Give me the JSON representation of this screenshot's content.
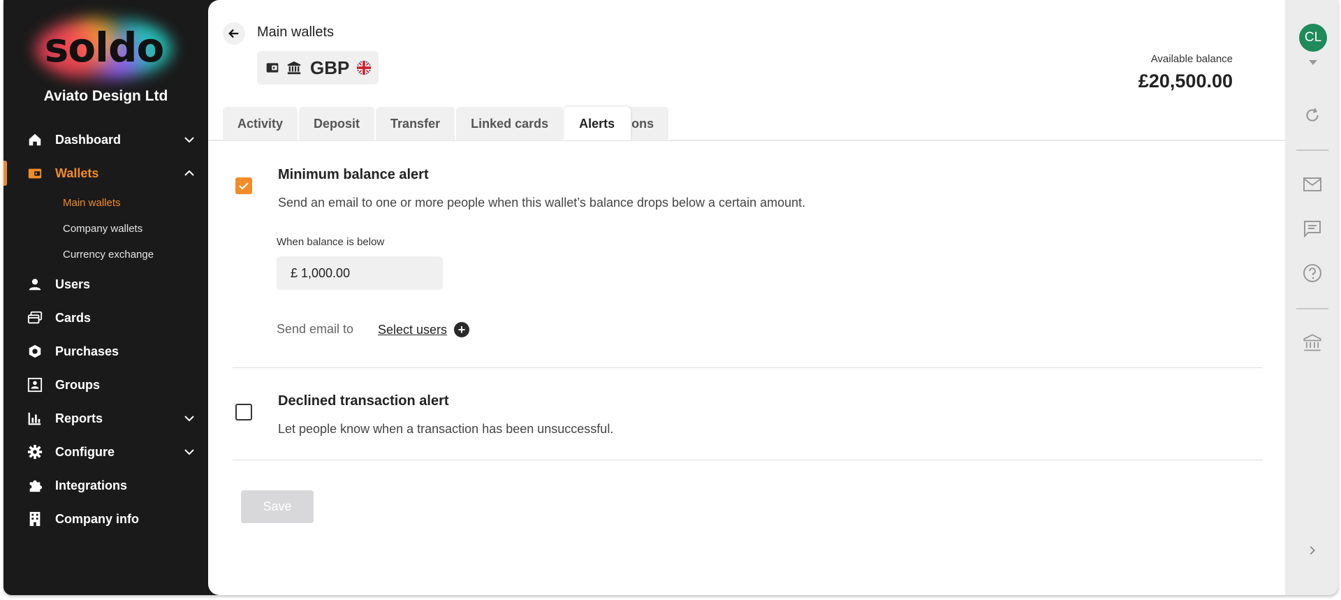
{
  "brand": {
    "logo_text": "soldo",
    "company_name": "Aviato Design Ltd",
    "accent_color": "#f28c28"
  },
  "sidebar": {
    "items": [
      {
        "label": "Dashboard",
        "icon": "home-icon",
        "expandable": true
      },
      {
        "label": "Wallets",
        "icon": "wallet-icon",
        "expandable": true,
        "active": true,
        "children": [
          "Main wallets",
          "Company wallets",
          "Currency exchange"
        ],
        "active_child": "Main wallets"
      },
      {
        "label": "Users",
        "icon": "user-icon"
      },
      {
        "label": "Cards",
        "icon": "cards-icon"
      },
      {
        "label": "Purchases",
        "icon": "purchases-icon"
      },
      {
        "label": "Groups",
        "icon": "groups-icon"
      },
      {
        "label": "Reports",
        "icon": "bar-chart-icon",
        "expandable": true
      },
      {
        "label": "Configure",
        "icon": "gear-icon",
        "expandable": true
      },
      {
        "label": "Integrations",
        "icon": "puzzle-icon"
      },
      {
        "label": "Company info",
        "icon": "building-icon"
      }
    ]
  },
  "header": {
    "title": "Main wallets",
    "currency": "GBP",
    "balance_label": "Available balance",
    "balance_value": "£20,500.00"
  },
  "tabs": [
    {
      "label": "Activity"
    },
    {
      "label": "Deposit"
    },
    {
      "label": "Transfer"
    },
    {
      "label": "Linked cards"
    },
    {
      "label": "Alerts",
      "active": true
    },
    {
      "label": "tions"
    }
  ],
  "alerts": {
    "min_balance": {
      "title": "Minimum balance alert",
      "description": "Send an email to one or more people when this wallet’s balance drops below a certain amount.",
      "checked": true,
      "field_label": "When balance is below",
      "field_value": "£ 1,000.00",
      "send_label": "Send email to",
      "select_users": "Select users"
    },
    "declined": {
      "title": "Declined transaction alert",
      "description": "Let people know when a transaction has been unsuccessful.",
      "checked": false
    }
  },
  "actions": {
    "save_label": "Save"
  },
  "user": {
    "initials": "CL",
    "avatar_color": "#1f8a5a"
  }
}
